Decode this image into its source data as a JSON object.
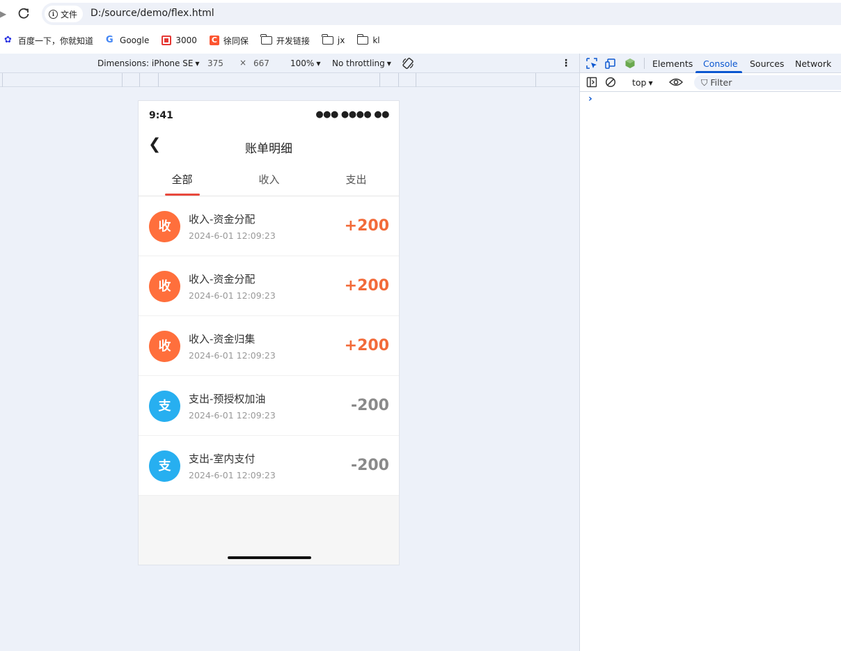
{
  "browser": {
    "security_chip": "文件",
    "url": "D:/source/demo/flex.html",
    "bookmarks": [
      {
        "label": "百度一下，你就知道",
        "icon": "baidu-icon"
      },
      {
        "label": "Google",
        "icon": "google-icon"
      },
      {
        "label": "3000",
        "icon": "red-book-icon"
      },
      {
        "label": "徐同保",
        "icon": "csdn-icon"
      },
      {
        "label": "开发链接",
        "icon": "folder-icon"
      },
      {
        "label": "jx",
        "icon": "folder-icon"
      },
      {
        "label": "kl",
        "icon": "folder-icon"
      }
    ]
  },
  "device_toolbar": {
    "dimensions_label": "Dimensions: iPhone SE",
    "width": "375",
    "times": "×",
    "height": "667",
    "zoom": "100%",
    "throttling": "No throttling"
  },
  "phone": {
    "status_time": "9:41",
    "status_signal": "●●● ●●●● ●●",
    "back_glyph": "❮",
    "title": "账单明细",
    "tabs": [
      "全部",
      "收入",
      "支出"
    ],
    "active_tab": 0,
    "records": [
      {
        "badge": "收",
        "title": "收入-资金分配",
        "date": "2024-6-01 12:09:23",
        "amount": "+200",
        "type": "income"
      },
      {
        "badge": "收",
        "title": "收入-资金分配",
        "date": "2024-6-01 12:09:23",
        "amount": "+200",
        "type": "income"
      },
      {
        "badge": "收",
        "title": "收入-资金归集",
        "date": "2024-6-01 12:09:23",
        "amount": "+200",
        "type": "income"
      },
      {
        "badge": "支",
        "title": "支出-预授权加油",
        "date": "2024-6-01 12:09:23",
        "amount": "-200",
        "type": "expense"
      },
      {
        "badge": "支",
        "title": "支出-室内支付",
        "date": "2024-6-01 12:09:23",
        "amount": "-200",
        "type": "expense"
      }
    ]
  },
  "colors": {
    "income_badge": "#ff6f3c",
    "expense_badge": "#27aff0",
    "income_amount": "#f26b3a",
    "expense_amount": "#8a8a8a",
    "tab_accent": "#e8493d",
    "devtools_accent": "#0b57d0"
  },
  "devtools": {
    "tabs": [
      "Elements",
      "Console",
      "Sources",
      "Network"
    ],
    "active_tab": "Console",
    "context": "top",
    "filter_placeholder": "Filter",
    "prompt": "›"
  }
}
